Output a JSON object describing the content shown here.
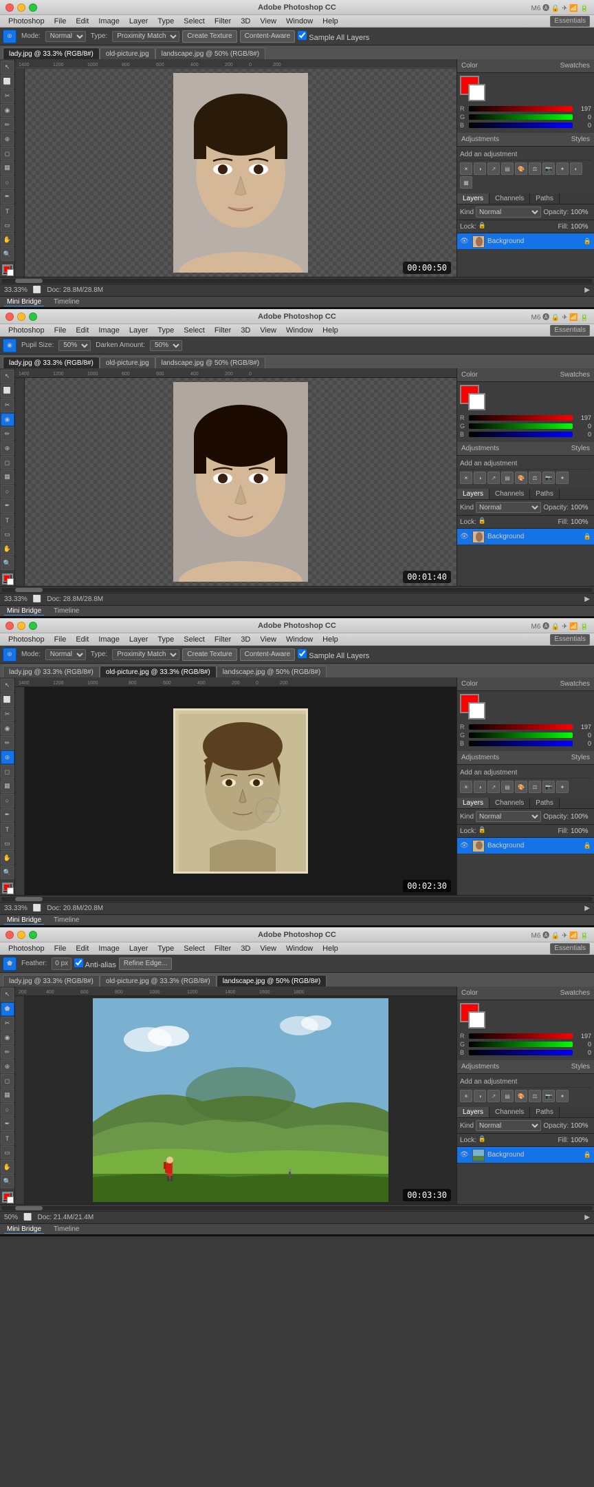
{
  "sections": [
    {
      "id": "section1",
      "titlebar": {
        "title": "Adobe Photoshop CC",
        "traffic": [
          "close",
          "minimize",
          "maximize"
        ],
        "right_icons": "M6 A2 ♣ ☁ 🔒 ✈",
        "timer": "00:00:50"
      },
      "menubar": [
        "Photoshop",
        "File",
        "Edit",
        "Image",
        "Layer",
        "Type",
        "Select",
        "Filter",
        "3D",
        "View",
        "Window",
        "Help"
      ],
      "toolbar": {
        "mode_label": "Mode:",
        "mode_value": "Normal",
        "type_label": "Type:",
        "type_value": "Proximity Match",
        "create_texture_btn": "Create Texture",
        "content_aware_btn": "Content-Aware",
        "sample_all_layers_cb": "Sample All Layers"
      },
      "doctabs": [
        "lady.jpg",
        "old-picture.jpg",
        "landscape.jpg"
      ],
      "active_tab": 0,
      "zoom": "33.33%",
      "doc_info": "Doc: 28.8M/28.8M",
      "status_zoom": "33.33%",
      "image_type": "lady.jpg @ 33.3% (RGB/8#)",
      "image_type2": "old-picture.jpg",
      "image_type3": "landscape.jpg @ 50% (RGB/8#)",
      "photo": "face1",
      "mini_bridge": [
        "Mini Bridge",
        "Timeline"
      ],
      "active_bridge": 0
    },
    {
      "id": "section2",
      "titlebar": {
        "title": "Adobe Photoshop CC",
        "timer": "00:01:40"
      },
      "menubar": [
        "Photoshop",
        "File",
        "Edit",
        "Image",
        "Layer",
        "Type",
        "Select",
        "Filter",
        "3D",
        "View",
        "Window",
        "Help"
      ],
      "toolbar": {
        "pupil_size_label": "Pupil Size:",
        "pupil_size_value": "50%",
        "darken_label": "Darken Amount:",
        "darken_value": "50%"
      },
      "doctabs": [
        "lady.jpg",
        "old-picture.jpg",
        "landscape.jpg"
      ],
      "active_tab": 0,
      "zoom": "33.33%",
      "doc_info": "Doc: 28.8M/28.8M",
      "image_type": "lady.jpg @ 33.3% (RGB/8#)",
      "image_type2": "old-picture.jpg",
      "image_type3": "landscape.jpg @ 50% (RGB/8#)",
      "photo": "face2",
      "mini_bridge": [
        "Mini Bridge",
        "Timeline"
      ],
      "active_bridge": 0
    },
    {
      "id": "section3",
      "titlebar": {
        "title": "Adobe Photoshop CC",
        "timer": "00:02:30"
      },
      "menubar": [
        "Photoshop",
        "File",
        "Edit",
        "Image",
        "Layer",
        "Type",
        "Select",
        "Filter",
        "3D",
        "View",
        "Window",
        "Help"
      ],
      "toolbar": {
        "mode_label": "Mode:",
        "mode_value": "Normal",
        "type_label": "Type:",
        "type_value": "Proximity Match",
        "create_texture_btn": "Create Texture",
        "content_aware_btn": "Content-Aware",
        "sample_all_layers_cb": "Sample All Layers"
      },
      "doctabs": [
        "lady.jpg",
        "old-picture.jpg",
        "landscape.jpg"
      ],
      "active_tab": 1,
      "zoom": "33.33%",
      "doc_info": "Doc: 20.8M/20.8M",
      "image_type": "lady.jpg @ 33.3% (RGB/8#)",
      "image_type2": "old-picture.jpg @ 33.3% (RGB/8#)",
      "image_type3": "landscape.jpg @ 50% (RGB/8#)",
      "photo": "old",
      "mini_bridge": [
        "Mini Bridge",
        "Timeline"
      ],
      "active_bridge": 0
    },
    {
      "id": "section4",
      "titlebar": {
        "title": "Adobe Photoshop CC",
        "timer": "00:03:30"
      },
      "menubar": [
        "Photoshop",
        "File",
        "Edit",
        "Image",
        "Layer",
        "Type",
        "Select",
        "Filter",
        "3D",
        "View",
        "Window",
        "Help"
      ],
      "toolbar": {
        "feather_label": "Feather:",
        "feather_value": "0 px",
        "anti_alias_cb": "Anti-alias",
        "refine_edge_btn": "Refine Edge..."
      },
      "doctabs": [
        "lady.jpg",
        "old-picture.jpg",
        "landscape.jpg"
      ],
      "active_tab": 2,
      "zoom": "50%",
      "doc_info": "Doc: 21.4M/21.4M",
      "image_type": "lady.jpg @ 33.3% (RGB/8#)",
      "image_type2": "old-picture.jpg @ 33.3% (RGB/8#)",
      "image_type3": "landscape.jpg @ 50% (RGB/8#)",
      "photo": "landscape",
      "mini_bridge": [
        "Mini Bridge",
        "Timeline"
      ],
      "active_bridge": 0
    }
  ],
  "right_panel": {
    "color_tab": "Color",
    "swatches_tab": "Swatches",
    "r_label": "R",
    "g_label": "G",
    "b_label": "B",
    "r_value": "197",
    "g_value": "0",
    "b_value": "0",
    "adjustments_tab": "Adjustments",
    "styles_tab": "Styles",
    "add_adjustment": "Add an adjustment",
    "layers_tab": "Layers",
    "channels_tab": "Channels",
    "paths_tab": "Paths",
    "kind_label": "Kind",
    "normal_label": "Normal",
    "opacity_label": "Opacity:",
    "opacity_value": "100%",
    "fill_label": "Fill:",
    "fill_value": "100%",
    "lock_label": "Lock:",
    "layer_name": "Background",
    "essentials_btn": "Essentials"
  },
  "tools": [
    "M",
    "L",
    "C",
    "S",
    "T",
    "G",
    "B",
    "E",
    "P",
    "H",
    "Z",
    "◉",
    "⊕"
  ],
  "select_label": "Select"
}
